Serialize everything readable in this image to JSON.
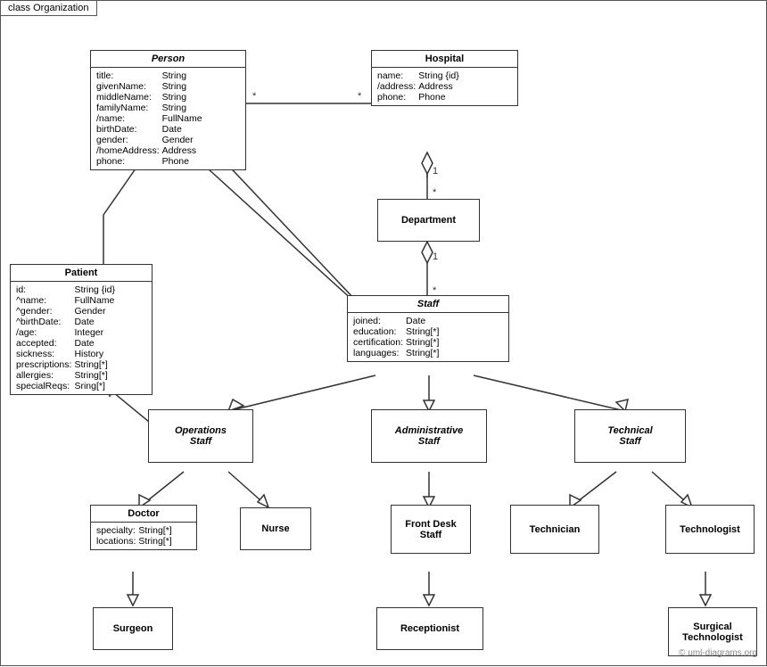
{
  "diagram": {
    "label": "class Organization",
    "watermark": "© uml-diagrams.org",
    "classes": {
      "person": {
        "title": "Person",
        "italic": true,
        "fields": [
          [
            "title:",
            "String"
          ],
          [
            "givenName:",
            "String"
          ],
          [
            "middleName:",
            "String"
          ],
          [
            "familyName:",
            "String"
          ],
          [
            "/name:",
            "FullName"
          ],
          [
            "birthDate:",
            "Date"
          ],
          [
            "gender:",
            "Gender"
          ],
          [
            "/homeAddress:",
            "Address"
          ],
          [
            "phone:",
            "Phone"
          ]
        ]
      },
      "hospital": {
        "title": "Hospital",
        "fields": [
          [
            "name:",
            "String {id}"
          ],
          [
            "/address:",
            "Address"
          ],
          [
            "phone:",
            "Phone"
          ]
        ]
      },
      "patient": {
        "title": "Patient",
        "fields": [
          [
            "id:",
            "String {id}"
          ],
          [
            "^name:",
            "FullName"
          ],
          [
            "^gender:",
            "Gender"
          ],
          [
            "^birthDate:",
            "Date"
          ],
          [
            "/age:",
            "Integer"
          ],
          [
            "accepted:",
            "Date"
          ],
          [
            "sickness:",
            "History"
          ],
          [
            "prescriptions:",
            "String[*]"
          ],
          [
            "allergies:",
            "String[*]"
          ],
          [
            "specialReqs:",
            "Sring[*]"
          ]
        ]
      },
      "department": {
        "title": "Department"
      },
      "staff": {
        "title": "Staff",
        "italic": true,
        "fields": [
          [
            "joined:",
            "Date"
          ],
          [
            "education:",
            "String[*]"
          ],
          [
            "certification:",
            "String[*]"
          ],
          [
            "languages:",
            "String[*]"
          ]
        ]
      },
      "operations_staff": {
        "title": "Operations Staff",
        "italic": true
      },
      "administrative_staff": {
        "title": "Administrative Staff",
        "italic": true
      },
      "technical_staff": {
        "title": "Technical Staff",
        "italic": true
      },
      "doctor": {
        "title": "Doctor",
        "fields": [
          [
            "specialty:",
            "String[*]"
          ],
          [
            "locations:",
            "String[*]"
          ]
        ]
      },
      "nurse": {
        "title": "Nurse"
      },
      "front_desk_staff": {
        "title": "Front Desk Staff"
      },
      "technician": {
        "title": "Technician"
      },
      "technologist": {
        "title": "Technologist"
      },
      "surgeon": {
        "title": "Surgeon"
      },
      "receptionist": {
        "title": "Receptionist"
      },
      "surgical_technologist": {
        "title": "Surgical Technologist"
      }
    },
    "multiplicities": {
      "person_hospital_star_left": "*",
      "person_hospital_star_right": "*",
      "hospital_department_1": "1",
      "hospital_department_star": "*",
      "department_staff_1": "1",
      "department_staff_star": "*",
      "patient_operations_star1": "*",
      "patient_operations_star2": "*"
    }
  }
}
